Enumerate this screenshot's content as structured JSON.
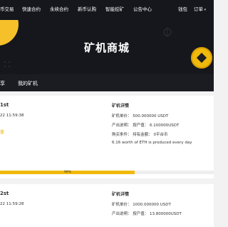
{
  "nav": {
    "items": [
      "币交易",
      "快速合约",
      "永续合约",
      "新币认购",
      "智能挖矿",
      "公告中心"
    ],
    "wallet": "钱包",
    "orders": "订单"
  },
  "hero": {
    "title": "矿机商城"
  },
  "tabs": [
    "享",
    "我的矿机"
  ],
  "products": [
    {
      "name": "1st",
      "time": "22 11:59:38",
      "status": "量",
      "detail_title": "矿机详情",
      "price": "矿机单价：  500.000000 USDT",
      "output": "产出说明：  按产值：  6.100000USDT",
      "purchase": "购买条件：  持有金额：  0平台币",
      "description": "6.16 worth of ETH is produced every day",
      "progress_label": "99%",
      "progress": 0.63
    },
    {
      "name": "2st",
      "time": "22 11:59:28",
      "detail_title": "矿机详情",
      "price": "矿机单价：  1000.000000 USDT",
      "output": "产出说明：  按产值：  13.800000USDT"
    }
  ],
  "colors": {
    "accent": "#f0b90b",
    "header_bg": "#15171c"
  }
}
